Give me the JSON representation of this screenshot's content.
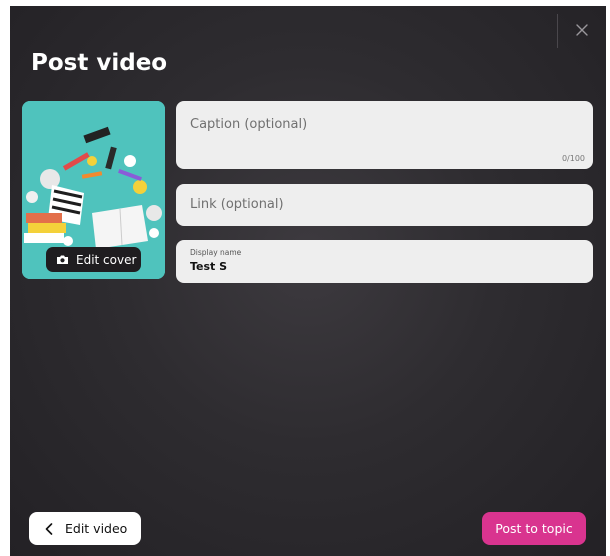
{
  "dialog": {
    "title": "Post video",
    "close_icon": "close-icon"
  },
  "cover": {
    "edit_label": "Edit cover",
    "icon": "camera-icon"
  },
  "form": {
    "caption": {
      "placeholder": "Caption (optional)",
      "counter": "0/100"
    },
    "link": {
      "placeholder": "Link (optional)"
    },
    "display_name": {
      "label": "Display name",
      "value": "Test S"
    }
  },
  "footer": {
    "back_label": "Edit video",
    "back_icon": "chevron-left-icon",
    "post_label": "Post to topic"
  },
  "colors": {
    "accent": "#d9348f",
    "background": "#2e2c30",
    "field": "#eeeeee"
  }
}
